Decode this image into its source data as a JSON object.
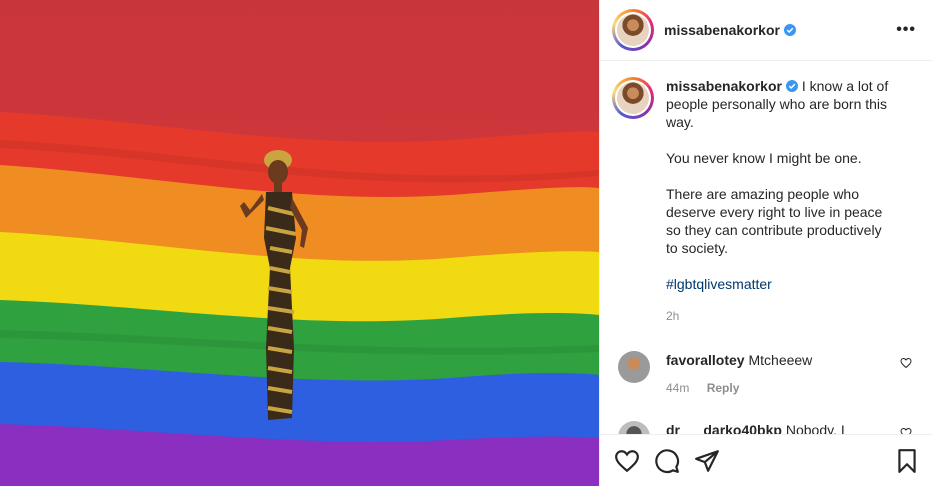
{
  "post": {
    "username": "missabenakorkor",
    "more_label": "•••",
    "caption": {
      "username": "missabenakorkor",
      "paragraphs": [
        "I know a lot of people personally who are born this way.",
        "You never know I might be one.",
        "There are amazing people who deserve every right to live in peace so they can contribute productively to society."
      ],
      "hashtag": "#lgbtqlivesmatter",
      "time": "2h"
    },
    "comments": [
      {
        "username": "favorallotey",
        "text": "Mtcheeew",
        "time": "44m",
        "reply_label": "Reply"
      },
      {
        "username": "dr___darko40bkp",
        "text": "Nobody, I",
        "time": "",
        "reply_label": ""
      }
    ]
  },
  "colors": {
    "verified": "#3897f0",
    "hashtag": "#00376b",
    "flag": [
      "#e03a2f",
      "#ee8a1f",
      "#f2d90f",
      "#2ea33f",
      "#2f62e0",
      "#8b2fbf"
    ]
  }
}
